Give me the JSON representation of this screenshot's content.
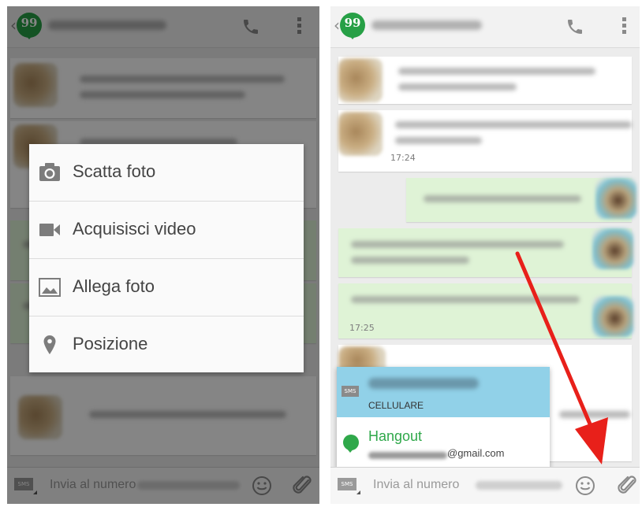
{
  "left_screen": {
    "attach_menu": {
      "items": [
        {
          "label": "Scatta foto",
          "icon": "camera-icon"
        },
        {
          "label": "Acquisisci video",
          "icon": "video-camera-icon"
        },
        {
          "label": "Allega foto",
          "icon": "image-icon"
        },
        {
          "label": "Posizione",
          "icon": "location-pin-icon"
        }
      ]
    },
    "compose": {
      "sms_badge": "SMS",
      "placeholder": "Invia al numero"
    }
  },
  "right_screen": {
    "messages": [
      {
        "time": "17:24"
      },
      {
        "time": "17:25"
      }
    ],
    "number_picker": {
      "sms_badge": "SMS",
      "cell_label": "CELLULARE",
      "hangout_label": "Hangout",
      "hangout_email": "@gmail.com"
    },
    "compose": {
      "sms_badge": "SMS",
      "placeholder": "Invia al numero"
    }
  },
  "colors": {
    "hangouts_green": "#27a046",
    "selected_cell": "#91d1e8",
    "sent_bubble": "#dff3d6",
    "arrow": "#e8201a"
  }
}
